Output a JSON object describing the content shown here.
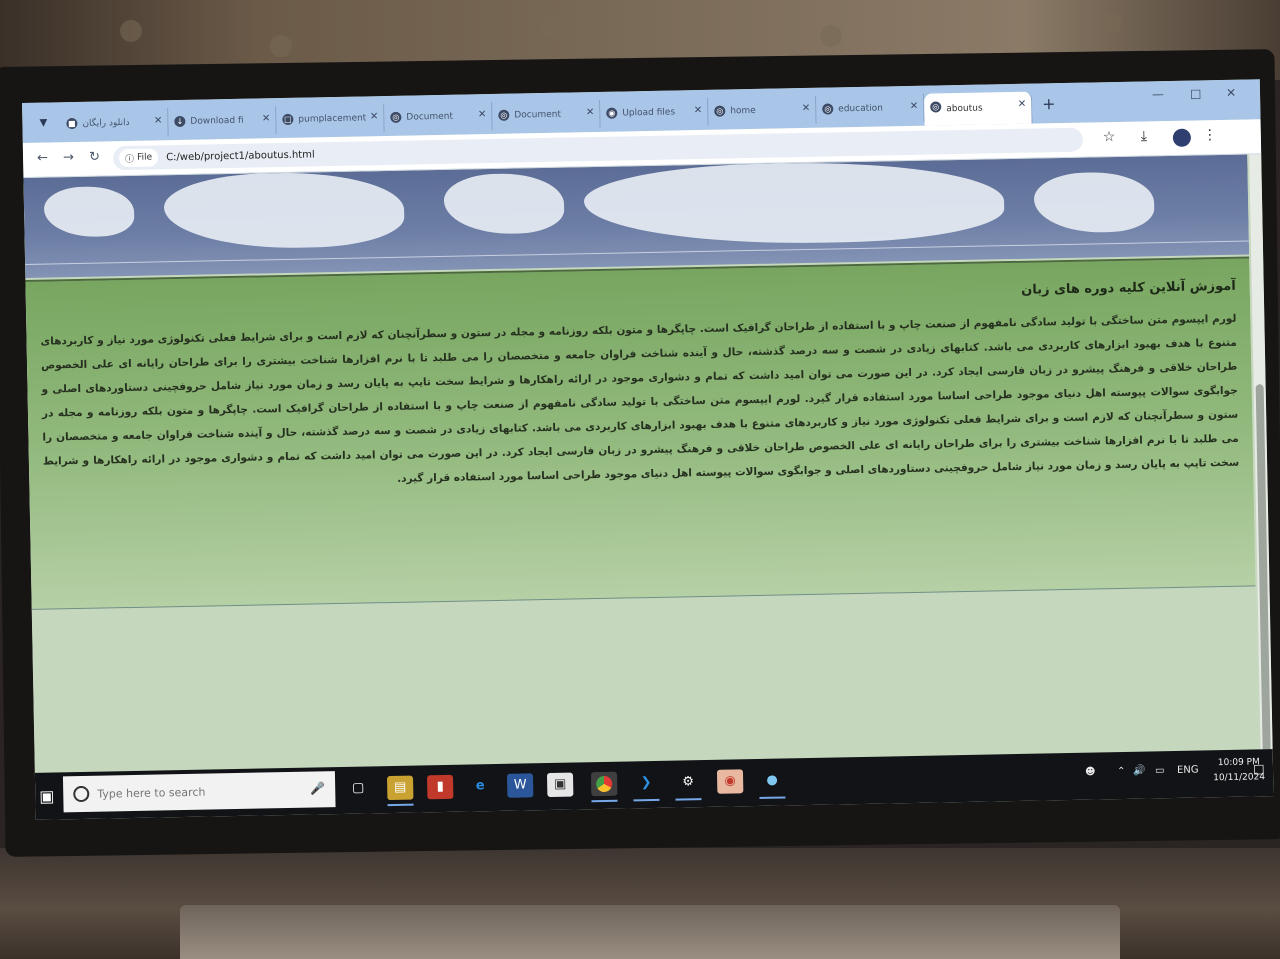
{
  "browser": {
    "tabs": [
      {
        "label": "دانلود رایگان",
        "icon": "bookmark-icon"
      },
      {
        "label": "Download fi",
        "icon": "download-icon"
      },
      {
        "label": "pumplacement",
        "icon": "page-icon"
      },
      {
        "label": "Document",
        "icon": "globe-icon"
      },
      {
        "label": "Document",
        "icon": "globe-icon"
      },
      {
        "label": "Upload files",
        "icon": "github-icon"
      },
      {
        "label": "home",
        "icon": "globe-icon"
      },
      {
        "label": "education",
        "icon": "globe-icon"
      },
      {
        "label": "aboutus",
        "icon": "globe-icon",
        "active": true
      }
    ],
    "new_tab": "+",
    "address": {
      "scheme_chip": "File",
      "url": "C:/web/project1/aboutus.html"
    }
  },
  "page": {
    "heading": "آموزش آنلاین کلیه دوره های زبان",
    "paragraph": "لورم ایپسوم متن ساختگی با تولید سادگی نامفهوم از صنعت چاپ و با استفاده از طراحان گرافیک است. چاپگرها و متون بلکه روزنامه و مجله در ستون و سطرآنچنان که لازم است و برای شرایط فعلی تکنولوژی مورد نیاز و کاربردهای متنوع با هدف بهبود ابزارهای کاربردی می باشد. کتابهای زیادی در شصت و سه درصد گذشته، حال و آینده شناخت فراوان جامعه و متخصصان را می طلبد تا با نرم افزارها شناخت بیشتری را برای طراحان رایانه ای علی الخصوص طراحان خلاقی و فرهنگ پیشرو در زبان فارسی ایجاد کرد. در این صورت می توان امید داشت که تمام و دشواری موجود در ارائه راهکارها و شرایط سخت تایپ به پایان رسد و زمان مورد نیاز شامل حروفچینی دستاوردهای اصلی و جوابگوی سوالات پیوسته اهل دنیای موجود طراحی اساسا مورد استفاده قرار گیرد. لورم ایپسوم متن ساختگی با تولید سادگی نامفهوم از صنعت چاپ و با استفاده از طراحان گرافیک است. چاپگرها و متون بلکه روزنامه و مجله در ستون و سطرآنچنان که لازم است و برای شرایط فعلی تکنولوژی مورد نیاز و کاربردهای متنوع با هدف بهبود ابزارهای کاربردی می باشد. کتابهای زیادی در شصت و سه درصد گذشته، حال و آینده شناخت فراوان جامعه و متخصصان را می طلبد تا با نرم افزارها شناخت بیشتری را برای طراحان رایانه ای علی الخصوص طراحان خلاقی و فرهنگ پیشرو در زبان فارسی ایجاد کرد. در این صورت می توان امید داشت که تمام و دشواری موجود در ارائه راهکارها و شرایط سخت تایپ به پایان رسد و زمان مورد نیاز شامل حروفچینی دستاوردهای اصلی و جوابگوی سوالات پیوسته اهل دنیای موجود طراحی اساسا مورد استفاده قرار گیرد."
  },
  "taskbar": {
    "search_placeholder": "Type here to search",
    "apps": [
      "task-view-icon",
      "file-explorer-icon",
      "pdf-reader-icon",
      "edge-icon",
      "word-icon",
      "store-icon",
      "chrome-icon",
      "vscode-icon",
      "settings-icon",
      "paint-icon",
      "app-icon"
    ],
    "language": "ENG",
    "time": "10:09 PM",
    "date": "10/11/2024"
  },
  "colors": {
    "tab_strip": "#a9c6e8",
    "content_green_top": "#78a660",
    "content_green_bottom": "#b6d0a6",
    "taskbar": "#111317"
  }
}
